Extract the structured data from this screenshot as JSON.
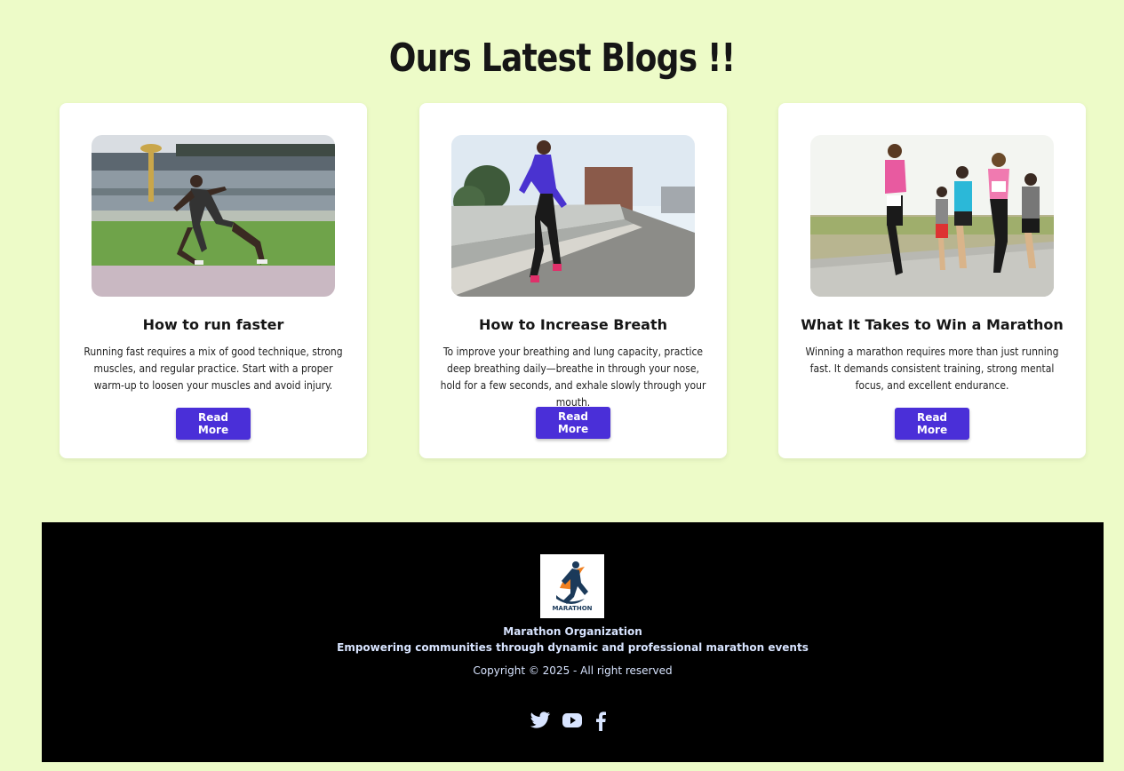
{
  "page_title": "Ours Latest Blogs !!",
  "cards": [
    {
      "title": "How to run faster",
      "text": "Running fast requires a mix of good technique, strong muscles, and regular practice. Start with a proper warm-up to loosen your muscles and avoid injury.",
      "button": "Read More"
    },
    {
      "title": "How to Increase Breath",
      "text": "To improve your breathing and lung capacity, practice deep breathing daily—breathe in through your nose, hold for a few seconds, and exhale slowly through your mouth.",
      "button": "Read More"
    },
    {
      "title": "What It Takes to Win a Marathon",
      "text": "Winning a marathon requires more than just running fast. It demands consistent training, strong mental focus, and excellent endurance.",
      "button": "Read More"
    }
  ],
  "footer": {
    "logo_text": "MARATHON",
    "org_name": "Marathon Organization",
    "tagline": "Empowering communities through dynamic and professional marathon events",
    "copyright": "Copyright © 2025 - All right reserved",
    "socials": [
      "twitter-icon",
      "youtube-icon",
      "facebook-icon"
    ]
  },
  "colors": {
    "background": "#edfbc8",
    "button": "#4a2fd8",
    "footer_bg": "#000000",
    "footer_text": "#d8e4ff"
  }
}
